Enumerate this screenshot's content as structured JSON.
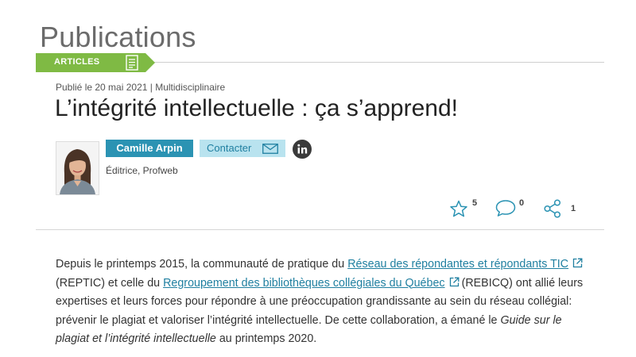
{
  "page": {
    "title": "Publications"
  },
  "section_tag": {
    "label": "ARTICLES",
    "icon": "document-icon",
    "color": "#7fba44"
  },
  "article": {
    "meta": "Publié le 20 mai 2021 | Multidisciplinaire",
    "title": "L’intégrité intellectuelle : ça s’apprend!"
  },
  "author": {
    "name": "Camille Arpin",
    "contact_label": "Contacter",
    "role": "Éditrice, Profweb",
    "linkedin_icon": "linkedin-icon"
  },
  "social": {
    "favorites": "5",
    "comments": "0",
    "shares": "1"
  },
  "body": {
    "t1": "Depuis le printemps 2015, la communauté de pratique du ",
    "link1": "Réseau des répondantes et répondants TIC",
    "t2": "(REPTIC) et celle du ",
    "link2": "Regroupement des bibliothèques collégiales du Québec",
    "t3": "(REBICQ) ont allié leurs expertises et leurs forces pour répondre à une préoccupation grandissante au sein du réseau collégial: prévenir le plagiat et valoriser l’intégrité intellectuelle. De cette collaboration, a émané le ",
    "guide": "Guide sur le plagiat et l’intégrité intellectuelle",
    "t4": " au printemps 2020."
  },
  "colors": {
    "accent": "#2b93b3",
    "link": "#1f7fa0",
    "contact_bg": "#b9e3ef"
  }
}
